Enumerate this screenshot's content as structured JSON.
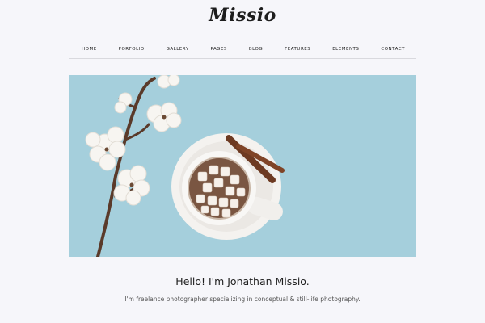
{
  "site": {
    "logo": "Missio"
  },
  "nav": {
    "items": [
      "HOME",
      "PORFOLIO",
      "GALLERY",
      "PAGES",
      "BLOG",
      "FEATURES",
      "ELEMENTS",
      "CONTACT"
    ]
  },
  "hero": {
    "image_icon": "cotton-and-cocoa-photo",
    "background_color": "#a5cfdc"
  },
  "intro": {
    "heading": "Hello! I'm Jonathan Missio.",
    "subtitle": "I'm freelance photographer specializing in conceptual & still-life photography."
  }
}
